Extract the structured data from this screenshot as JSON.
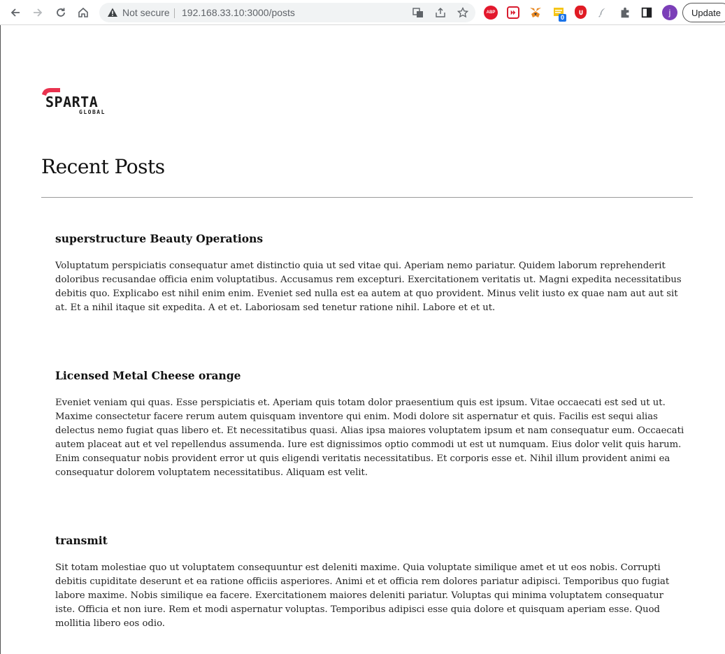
{
  "browser": {
    "security_label": "Not secure",
    "url": "192.168.33.10:3000/posts",
    "update_label": "Update",
    "profile_initial": "j",
    "extension_badge": "0",
    "abp_label": "ABP"
  },
  "logo": {
    "main": "SPARTA",
    "sub": "GLOBAL",
    "accent_color": "#e9334f",
    "text_color": "#1a1a1a"
  },
  "page": {
    "title": "Recent Posts"
  },
  "posts": [
    {
      "title": "superstructure Beauty Operations",
      "body": "Voluptatum perspiciatis consequatur amet distinctio quia ut sed vitae qui. Aperiam nemo pariatur. Quidem laborum reprehenderit doloribus recusandae officia enim voluptatibus. Accusamus rem excepturi. Exercitationem veritatis ut. Magni expedita necessitatibus debitis quo. Explicabo est nihil enim enim. Eveniet sed nulla est ea autem at quo provident. Minus velit iusto ex quae nam aut aut sit at. Et a nihil itaque sit expedita. A et et. Laboriosam sed tenetur ratione nihil. Labore et et ut."
    },
    {
      "title": "Licensed Metal Cheese orange",
      "body": "Eveniet veniam qui quas. Esse perspiciatis et. Aperiam quis totam dolor praesentium quis est ipsum. Vitae occaecati est sed ut ut. Maxime consectetur facere rerum autem quisquam inventore qui enim. Modi dolore sit aspernatur et quis. Facilis est sequi alias delectus nemo fugiat quas libero et. Et necessitatibus quasi. Alias ipsa maiores voluptatem ipsum et nam consequatur eum. Occaecati autem placeat aut et vel repellendus assumenda. Iure est dignissimos optio commodi ut est ut numquam. Eius dolor velit quis harum. Enim consequatur nobis provident error ut quis eligendi veritatis necessitatibus. Et corporis esse et. Nihil illum provident animi ea consequatur dolorem voluptatem necessitatibus. Aliquam est velit."
    },
    {
      "title": "transmit",
      "body": "Sit totam molestiae quo ut voluptatem consequuntur est deleniti maxime. Quia voluptate similique amet et ut eos nobis. Corrupti debitis cupiditate deserunt et ea ratione officiis asperiores. Animi et et officia rem dolores pariatur adipisci. Temporibus quo fugiat labore maxime. Nobis similique ea facere. Exercitationem maiores deleniti pariatur. Voluptas qui minima voluptatem consequatur iste. Officia et non iure. Rem et modi aspernatur voluptas. Temporibus adipisci esse quia dolore et quisquam aperiam esse. Quod mollitia libero eos odio."
    }
  ]
}
